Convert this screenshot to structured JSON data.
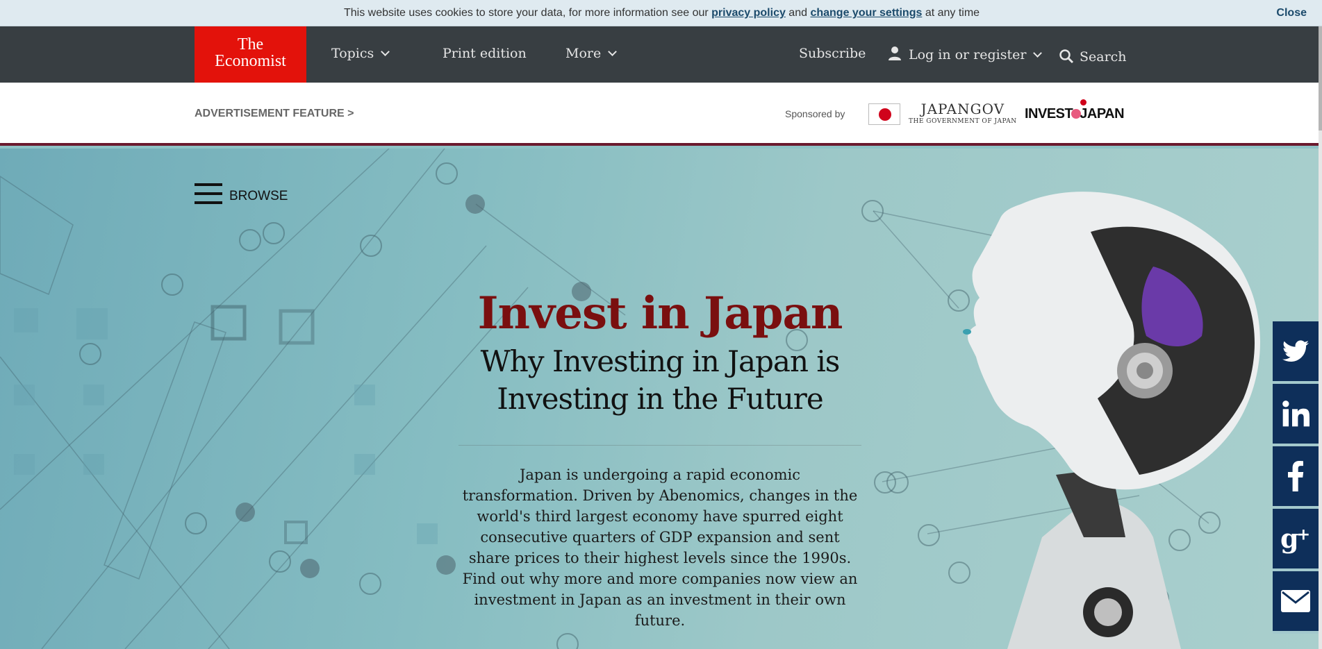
{
  "cookie_bar": {
    "text_before": "This website uses cookies to store your data, for more information see our ",
    "privacy_link": "privacy policy",
    "text_middle": " and ",
    "settings_link": "change your settings",
    "text_after": " at any time",
    "close_label": "Close"
  },
  "nav": {
    "logo_line1": "The",
    "logo_line2": "Economist",
    "topics": "Topics",
    "print_edition": "Print edition",
    "more": "More",
    "subscribe": "Subscribe",
    "login": "Log in or register",
    "search": "Search"
  },
  "ad_bar": {
    "label": "ADVERTISEMENT FEATURE >",
    "sponsored_by": "Sponsored by",
    "japangov_title": "JAPANGOV",
    "japangov_subtitle": "THE GOVERNMENT OF JAPAN",
    "investjapan_left": "INVEST",
    "investjapan_right": "JAPAN"
  },
  "hero": {
    "browse_label": "BROWSE",
    "title": "Invest in Japan",
    "subtitle_line1": "Why Investing in Japan is",
    "subtitle_line2": "Investing in the Future",
    "body": "Japan is undergoing a rapid economic transformation. Driven by Abenomics, changes in the world's third largest economy have spurred eight consecutive quarters of GDP expansion and sent share prices to their highest levels since the 1990s. Find out why more and more companies now view an investment in Japan as an investment in their own future."
  },
  "social": [
    "twitter-icon",
    "linkedin-icon",
    "facebook-icon",
    "google-plus-icon",
    "email-icon"
  ],
  "colors": {
    "brand_red": "#e3120b",
    "nav_bg": "#383e42",
    "title_red": "#7a0f0f",
    "social_blue": "#0e2f5a"
  }
}
